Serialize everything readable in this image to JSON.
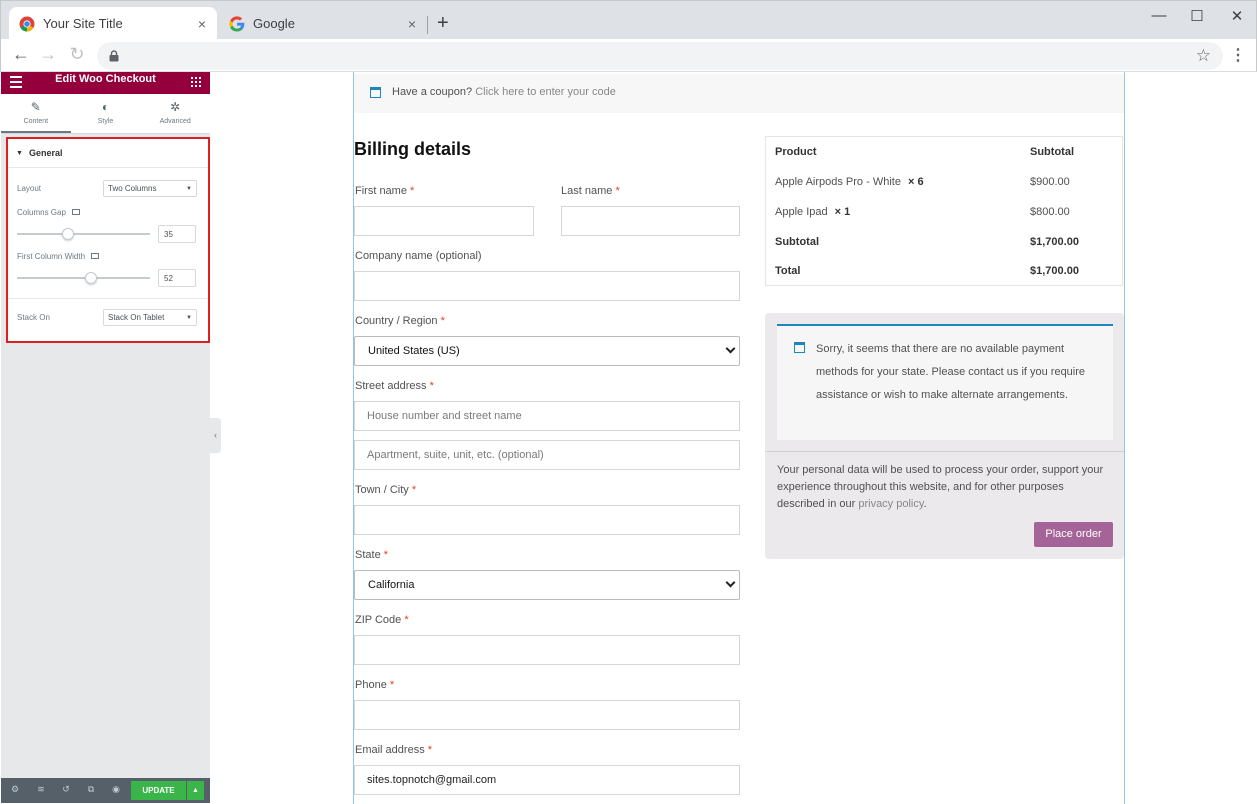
{
  "browser": {
    "tabs": [
      {
        "title": "Your Site Title",
        "close": "×"
      },
      {
        "title": "Google",
        "close": "×"
      }
    ],
    "new_tab": "+",
    "window": {
      "minimize": "—",
      "maximize": "☐",
      "close": "✕"
    },
    "nav": {
      "back": "←",
      "forward": "→",
      "reload": "↻"
    },
    "url": "",
    "star": "☆",
    "menu": "⋮"
  },
  "panel": {
    "title": "Edit Woo Checkout",
    "tabs": [
      {
        "icon": "✎",
        "label": "Content"
      },
      {
        "icon": "◐",
        "label": "Style"
      },
      {
        "icon": "✲",
        "label": "Advanced"
      }
    ],
    "section": {
      "caret": "▼",
      "title": "General",
      "layout_label": "Layout",
      "layout_value": "Two Columns",
      "columns_gap_label": "Columns Gap",
      "columns_gap_value": "35",
      "first_column_width_label": "First Column Width",
      "first_column_width_value": "52",
      "stack_on_label": "Stack On",
      "stack_on_value": "Stack On Tablet"
    },
    "footer": {
      "update": "UPDATE",
      "icons": [
        "⚙",
        "≋",
        "↺",
        "⧉",
        "◉"
      ],
      "arrow": "▲"
    },
    "collapse": "‹"
  },
  "coupon": {
    "text": "Have a coupon?",
    "link": "Click here to enter your code"
  },
  "billing": {
    "heading": "Billing details",
    "required_mark": "*",
    "first_name": "First name",
    "last_name": "Last name",
    "company": "Company name (optional)",
    "country_label": "Country / Region",
    "country_value": "United States (US)",
    "street_label": "Street address",
    "street_placeholder_1": "House number and street name",
    "street_placeholder_2": "Apartment, suite, unit, etc. (optional)",
    "city": "Town / City",
    "state_label": "State",
    "state_value": "California",
    "zip": "ZIP Code",
    "phone": "Phone",
    "email_label": "Email address",
    "email_value": "sites.topnotch@gmail.com"
  },
  "order": {
    "header_product": "Product",
    "header_subtotal": "Subtotal",
    "items": [
      {
        "name": "Apple Airpods Pro - White",
        "qty": "× 6",
        "price": "$900.00"
      },
      {
        "name": "Apple Ipad",
        "qty": "× 1",
        "price": "$800.00"
      }
    ],
    "subtotal_label": "Subtotal",
    "subtotal_value": "$1,700.00",
    "total_label": "Total",
    "total_value": "$1,700.00"
  },
  "payment": {
    "notice": "Sorry, it seems that there are no available payment methods for your state. Please contact us if you require assistance or wish to make alternate arrangements.",
    "privacy_text": "Your personal data will be used to process your order, support your experience throughout this website, and for other purposes described in our",
    "privacy_link": "privacy policy",
    "privacy_end": ".",
    "place_order": "Place order"
  }
}
